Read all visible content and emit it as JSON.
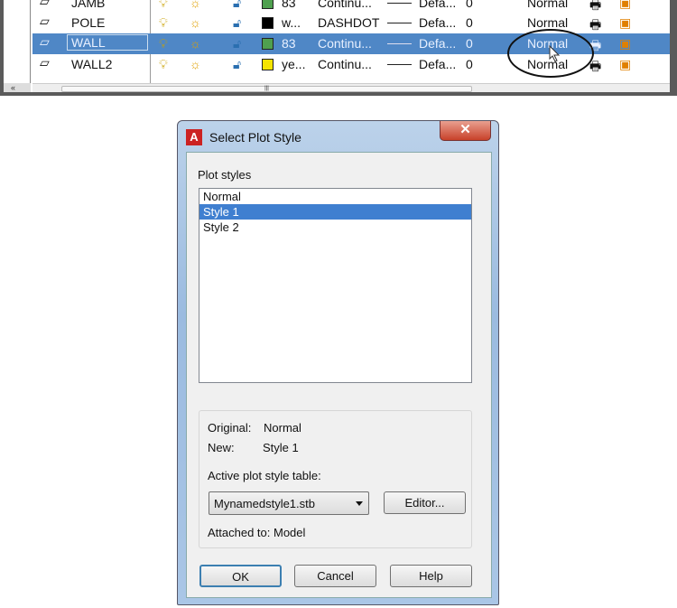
{
  "layers": [
    {
      "name": "JAMB",
      "color": "#4fa04f",
      "color_label": "83",
      "linetype": "Continu...",
      "lineweight": "Defa...",
      "transparency": "0",
      "plot_style": "Normal",
      "selected": false
    },
    {
      "name": "POLE",
      "color": "#000000",
      "color_label": "w...",
      "linetype": "DASHDOT",
      "lineweight": "Defa...",
      "transparency": "0",
      "plot_style": "Normal",
      "selected": false
    },
    {
      "name": "WALL",
      "color": "#4fa04f",
      "color_label": "83",
      "linetype": "Continu...",
      "lineweight": "Defa...",
      "transparency": "0",
      "plot_style": "Normal",
      "selected": true
    },
    {
      "name": "WALL2",
      "color": "#f5e400",
      "color_label": "ye...",
      "linetype": "Continu...",
      "lineweight": "Defa...",
      "transparency": "0",
      "plot_style": "Normal",
      "selected": false
    }
  ],
  "dialog": {
    "title": "Select Plot Style",
    "close": "✕",
    "plot_styles_label": "Plot styles",
    "styles": [
      "Normal",
      "Style 1",
      "Style 2"
    ],
    "selected_style": "Style 1",
    "original_label": "Original:",
    "original_value": "Normal",
    "new_label": "New:",
    "new_value": "Style 1",
    "table_label": "Active plot style table:",
    "table_value": "Mynamedstyle1.stb",
    "editor": "Editor...",
    "attached": "Attached to: Model",
    "ok": "OK",
    "cancel": "Cancel",
    "help": "Help"
  }
}
